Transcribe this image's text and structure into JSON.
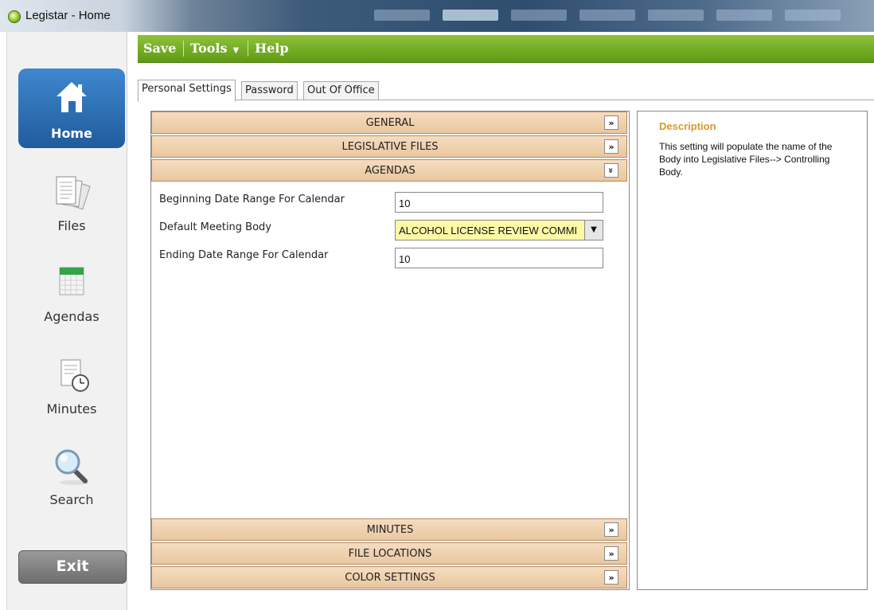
{
  "window": {
    "title": "Legistar - Home"
  },
  "menu": {
    "save": "Save",
    "tools": "Tools",
    "help": "Help"
  },
  "sidebar": {
    "items": [
      {
        "label": "Home",
        "icon": "home-icon",
        "active": true
      },
      {
        "label": "Files",
        "icon": "files-icon"
      },
      {
        "label": "Agendas",
        "icon": "calendar-icon"
      },
      {
        "label": "Minutes",
        "icon": "clock-document-icon"
      },
      {
        "label": "Search",
        "icon": "magnifier-icon"
      }
    ],
    "exit_label": "Exit"
  },
  "tabs": [
    "Personal Settings",
    "Password",
    "Out Of Office"
  ],
  "sections": {
    "general": "GENERAL",
    "legislative_files": "LEGISLATIVE FILES",
    "agendas": "AGENDAS",
    "minutes": "MINUTES",
    "file_locations": "FILE LOCATIONS",
    "color_settings": "COLOR SETTINGS",
    "collapsed_glyph": "»",
    "expanded_glyph": "»"
  },
  "agendas_fields": [
    {
      "label": "Beginning Date Range For Calendar",
      "value": "10"
    },
    {
      "label": "Default Meeting Body",
      "value": "ALCOHOL LICENSE REVIEW COMMI"
    },
    {
      "label": "Ending Date Range For Calendar",
      "value": "10"
    }
  ],
  "description": {
    "title": "Description",
    "text": "This setting will populate the name of the Body into Legislative Files--> Controlling Body."
  },
  "colors": {
    "menubar_green": "#6fa91f",
    "home_blue": "#2a6db2",
    "section_tan": "#efd1b0",
    "dropdown_yellow": "#fff9a6",
    "description_orange": "#d99a2b"
  }
}
